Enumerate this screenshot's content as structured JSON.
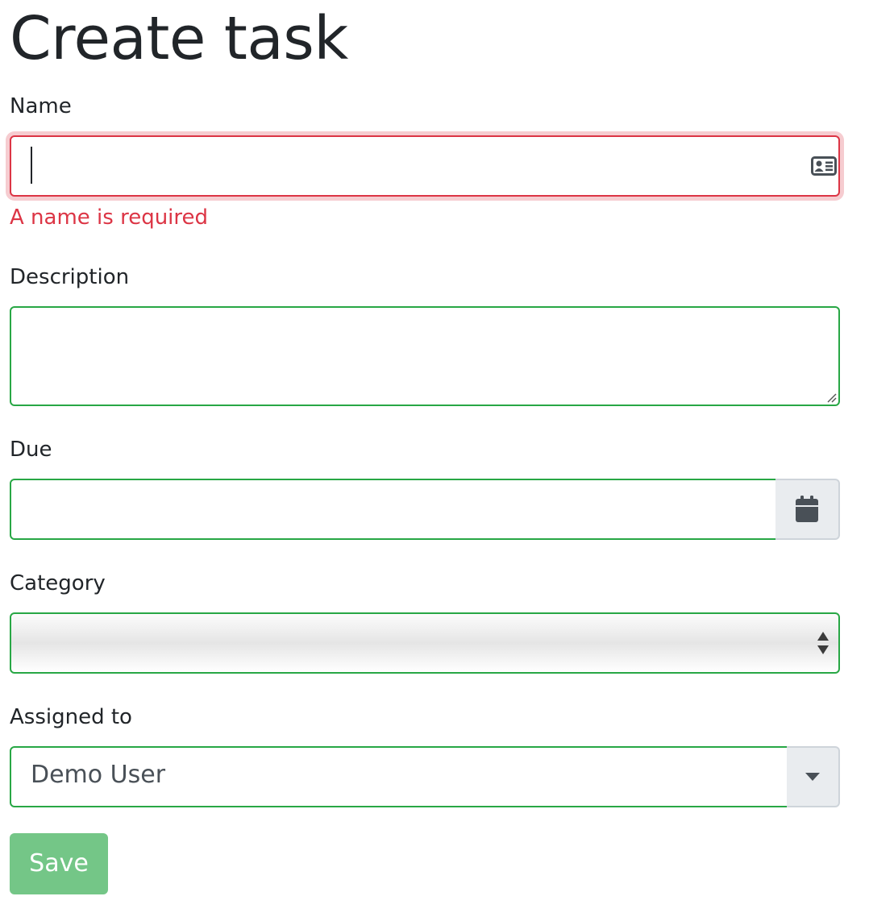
{
  "page": {
    "title": "Create task"
  },
  "form": {
    "name": {
      "label": "Name",
      "value": "",
      "icon": "id-card-icon",
      "error": "A name is required"
    },
    "description": {
      "label": "Description",
      "value": ""
    },
    "due": {
      "label": "Due",
      "value": "",
      "icon": "calendar-icon"
    },
    "category": {
      "label": "Category",
      "selected": ""
    },
    "assigned_to": {
      "label": "Assigned to",
      "selected": "Demo User",
      "icon": "caret-down-icon"
    },
    "save_label": "Save"
  },
  "colors": {
    "valid_border": "#28a745",
    "invalid_border": "#dc3545",
    "save_button": "#74c687",
    "addon_background": "#e9ecef"
  }
}
